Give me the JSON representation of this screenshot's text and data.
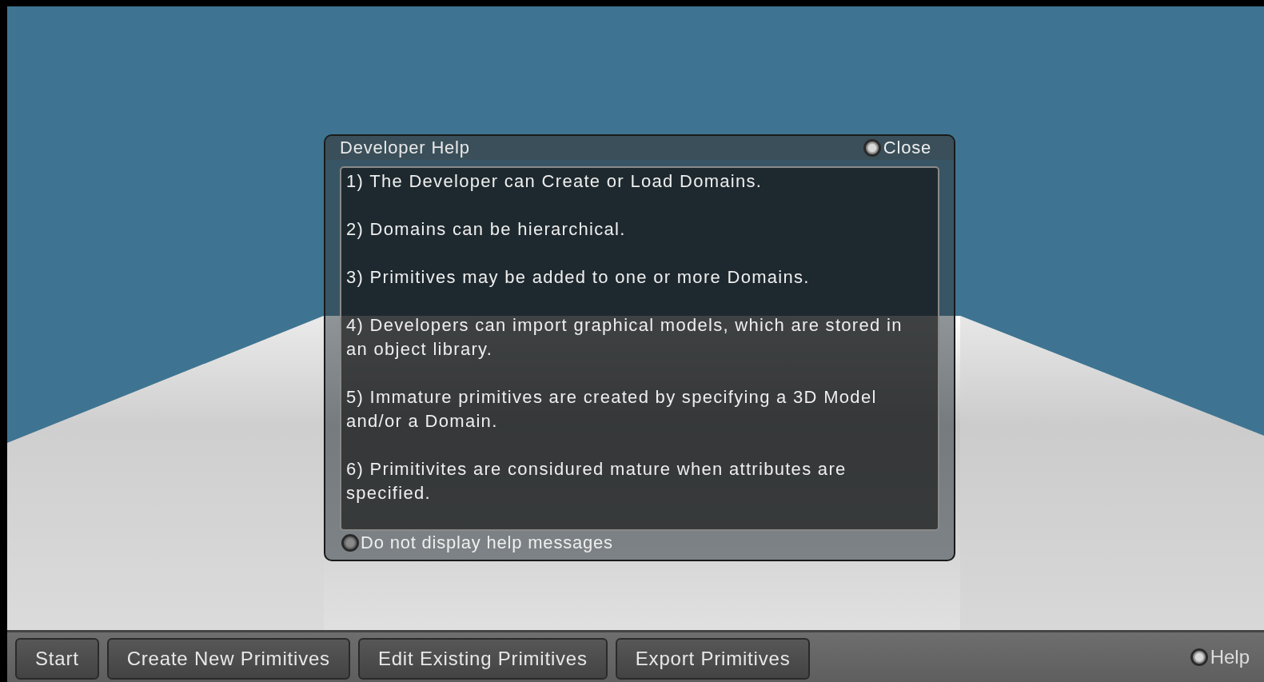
{
  "dialog": {
    "title": "Developer Help",
    "close": {
      "label": "Close"
    },
    "messages": [
      "1) The Developer can Create or Load Domains.",
      "2) Domains can be hierarchical.",
      "3) Primitives may be added to one or more Domains.",
      "4) Developers can import graphical models, which are stored in an object library.",
      "5) Immature primitives are created by specifying a 3D Model and/or a Domain.",
      "6) Primitivites are considured mature when attributes are specified."
    ],
    "option": {
      "label": "Do not display help messages",
      "checked": false
    }
  },
  "toolbar": {
    "buttons": [
      "Start",
      "Create New Primitives",
      "Edit Existing Primitives",
      "Export Primitives"
    ],
    "help": {
      "label": "Help"
    }
  }
}
